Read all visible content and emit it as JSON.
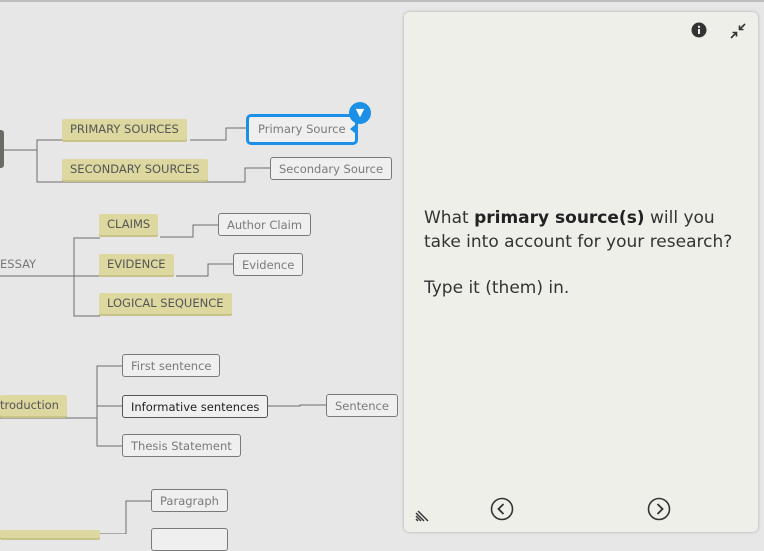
{
  "mindmap": {
    "essay_label": "ESSAY",
    "introduction_label": "troduction",
    "branches": {
      "primary_sources": "PRIMARY SOURCES",
      "secondary_sources": "SECONDARY SOURCES",
      "claims": "CLAIMS",
      "evidence": "EVIDENCE",
      "logical_sequence": "LOGICAL SEQUENCE"
    },
    "leaves": {
      "primary_source": "Primary Source",
      "secondary_source": "Secondary Source",
      "author_claim": "Author Claim",
      "evidence": "Evidence",
      "first_sentence": "First sentence",
      "informative_sentences": "Informative sentences",
      "sentence": "Sentence",
      "thesis_statement": "Thesis Statement",
      "paragraph": "Paragraph"
    }
  },
  "panel": {
    "question_prefix": "What ",
    "question_bold": "primary source(s)",
    "question_suffix": " will you take into account for your research?",
    "instruction": "Type it (them) in.",
    "icons": {
      "info": "info-icon",
      "collapse": "collapse-icon",
      "resize": "resize-grip-icon",
      "prev": "chevron-left-circle-icon",
      "next": "chevron-right-circle-icon"
    }
  },
  "colors": {
    "branch_bg": "#ddd8a0",
    "accent": "#1c8fe6",
    "canvas_bg": "#e7e7e8",
    "panel_bg": "#efefea"
  }
}
